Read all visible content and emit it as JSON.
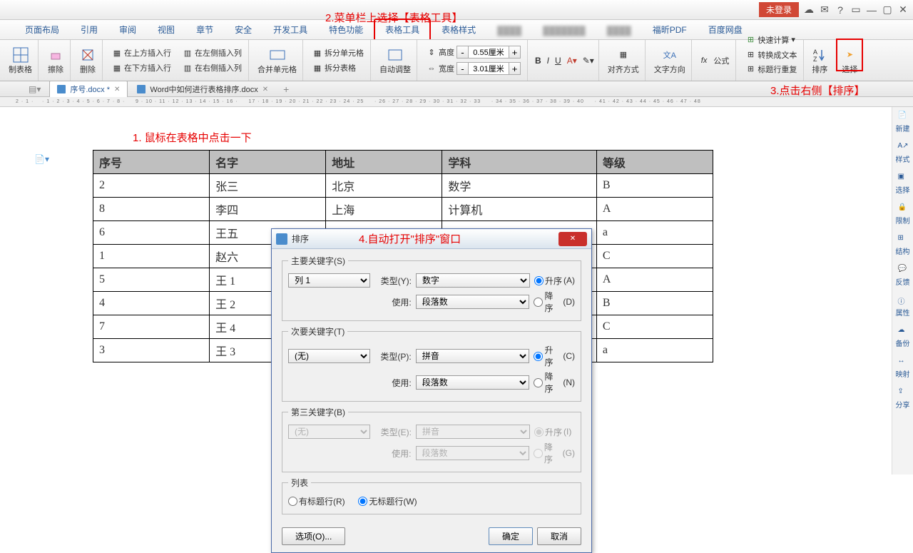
{
  "titlebar": {
    "login": "未登录"
  },
  "annotations": {
    "a1": "1. 鼠标在表格中点击一下",
    "a2": "2.菜单栏上选择【表格工具】",
    "a3": "3.点击右侧【排序】",
    "a4": "4.自动打开\"排序\"窗口"
  },
  "menu": [
    "页面布局",
    "引用",
    "审阅",
    "视图",
    "章节",
    "安全",
    "开发工具",
    "特色功能",
    "表格工具",
    "表格样式",
    "",
    "",
    "",
    "福昕PDF",
    "百度网盘"
  ],
  "ribbon": {
    "make_table": "制表格",
    "erase": "擦除",
    "delete": "删除",
    "ins_above": "在上方插入行",
    "ins_below": "在下方插入行",
    "ins_left": "在左侧插入列",
    "ins_right": "在右侧插入列",
    "merge": "合并单元格",
    "split_cell": "拆分单元格",
    "split_table": "拆分表格",
    "auto_adj": "自动调整",
    "height": "高度",
    "width": "宽度",
    "hval": "0.55厘米",
    "wval": "3.01厘米",
    "align": "对齐方式",
    "text_dir": "文字方向",
    "formula": "公式",
    "fast_calc": "快速计算",
    "title_repeat": "标题行重复",
    "conv_text": "转换成文本",
    "sort": "排序",
    "select": "选择"
  },
  "tabs": {
    "t1": "序号.docx *",
    "t2": "Word中如何进行表格排序.docx"
  },
  "table": {
    "headers": [
      "序号",
      "名字",
      "地址",
      "学科",
      "等级"
    ],
    "rows": [
      [
        "2",
        "张三",
        "北京",
        "数学",
        "B"
      ],
      [
        "8",
        "李四",
        "上海",
        "计算机",
        "A"
      ],
      [
        "6",
        "王五",
        "",
        "",
        "a"
      ],
      [
        "1",
        "赵六",
        "",
        "",
        "C"
      ],
      [
        "5",
        "王 1",
        "",
        "",
        "A"
      ],
      [
        "4",
        "王 2",
        "",
        "",
        "B"
      ],
      [
        "7",
        "王 4",
        "",
        "",
        "C"
      ],
      [
        "3",
        "王 3",
        "",
        "",
        "a"
      ]
    ]
  },
  "side": [
    "新建",
    "样式",
    "选择",
    "限制",
    "结构",
    "反馈",
    "属性",
    "备份",
    "映射",
    "分享"
  ],
  "dialog": {
    "title": "排序",
    "primary": "主要关键字(S)",
    "secondary": "次要关键字(T)",
    "third": "第三关键字(B)",
    "type": "类型",
    "use": "使用",
    "asc": "升序",
    "desc": "降序",
    "type_suffix_y": "(Y)",
    "type_suffix_p": "(P)",
    "type_suffix_e": "(E)",
    "asc_suffix_a": "(A)",
    "asc_suffix_c": "(C)",
    "asc_suffix_i": "(I)",
    "desc_suffix_d": "(D)",
    "desc_suffix_n": "(N)",
    "desc_suffix_g": "(G)",
    "col1": "列 1",
    "none": "(无)",
    "num": "数字",
    "pinyin": "拼音",
    "para": "段落数",
    "list": "列表",
    "has_title": "有标题行(R)",
    "no_title": "无标题行(W)",
    "options": "选项(O)...",
    "ok": "确定",
    "cancel": "取消"
  }
}
